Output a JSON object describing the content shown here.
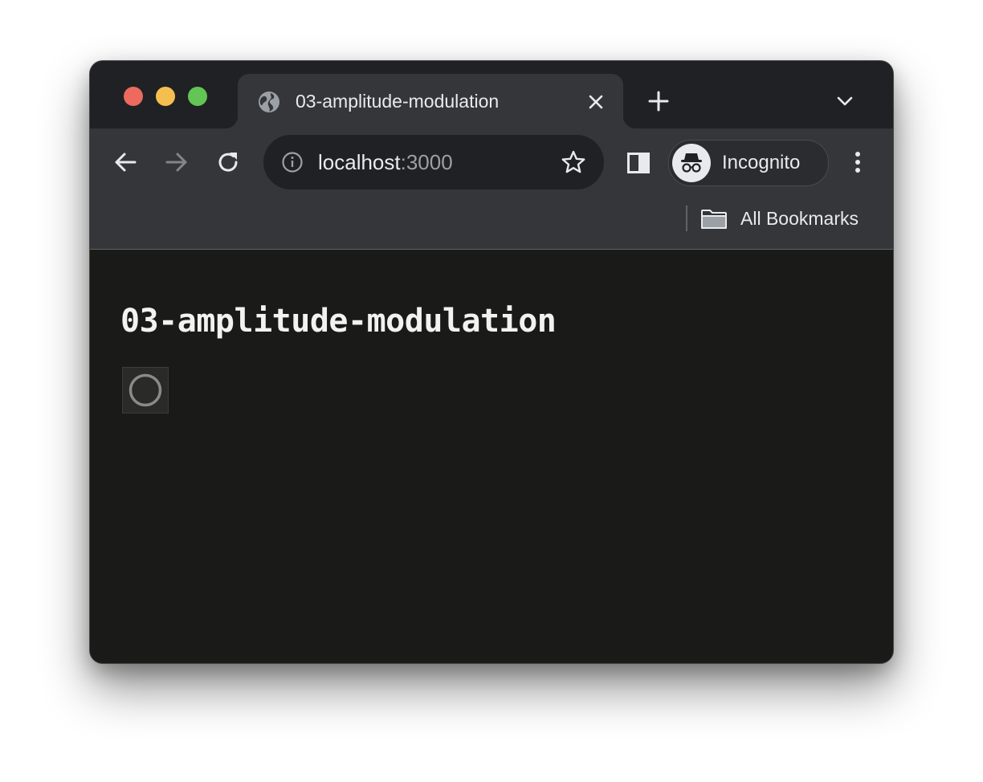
{
  "tab": {
    "title": "03-amplitude-modulation",
    "favicon": "globe-icon"
  },
  "omnibox": {
    "host": "localhost",
    "port": ":3000"
  },
  "profile": {
    "label": "Incognito"
  },
  "bookmarks": {
    "label": "All Bookmarks"
  },
  "page": {
    "heading": "03-amplitude-modulation",
    "loader_icon": "circle-icon"
  },
  "colors": {
    "titlebar": "#202124",
    "toolbar": "#35363a",
    "content_bg": "#1a1a19",
    "traffic_red": "#ed6a5e",
    "traffic_yellow": "#f5bf4f",
    "traffic_green": "#62c554"
  }
}
